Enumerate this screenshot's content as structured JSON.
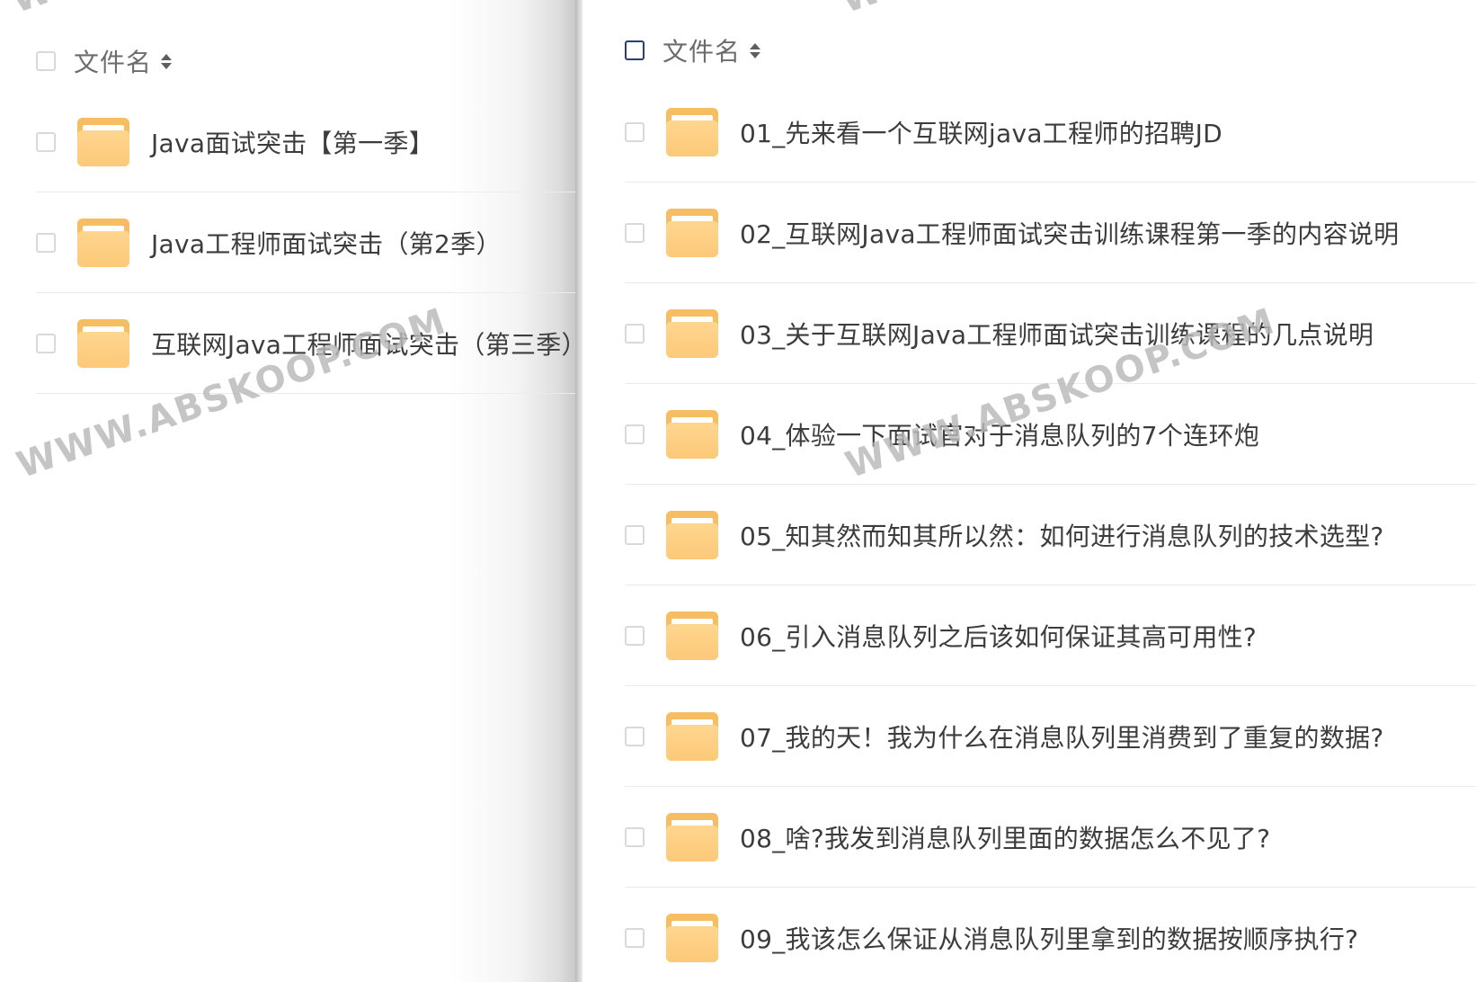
{
  "left_panel": {
    "header": {
      "label": "文件名"
    },
    "items": [
      {
        "label": "Java面试突击【第一季】"
      },
      {
        "label": "Java工程师面试突击（第2季）"
      },
      {
        "label": "互联网Java工程师面试突击（第三季）"
      }
    ]
  },
  "right_panel": {
    "header": {
      "label": "文件名"
    },
    "items": [
      {
        "label": "01_先来看一个互联网java工程师的招聘JD"
      },
      {
        "label": "02_互联网Java工程师面试突击训练课程第一季的内容说明"
      },
      {
        "label": "03_关于互联网Java工程师面试突击训练课程的几点说明"
      },
      {
        "label": "04_体验一下面试官对于消息队列的7个连环炮"
      },
      {
        "label": "05_知其然而知其所以然：如何进行消息队列的技术选型?"
      },
      {
        "label": "06_引入消息队列之后该如何保证其高可用性?"
      },
      {
        "label": "07_我的天！我为什么在消息队列里消费到了重复的数据?"
      },
      {
        "label": "08_啥?我发到消息队列里面的数据怎么不见了?"
      },
      {
        "label": "09_我该怎么保证从消息队列里拿到的数据按顺序执行?"
      }
    ]
  },
  "watermark": {
    "text": "WWW.ABSKOOP.COM",
    "partial_text": "WW"
  },
  "icons": {
    "folder": "folder-icon",
    "sort": "sort-icon",
    "checkbox": "checkbox"
  },
  "colors": {
    "folder": "#f6bd63",
    "folder_front": "#ffd68f",
    "text": "#3c3c3c",
    "header_text": "#6c6c6c",
    "checkbox_border": "#d9d9d9",
    "checkbox_focus": "#2c3e78"
  }
}
